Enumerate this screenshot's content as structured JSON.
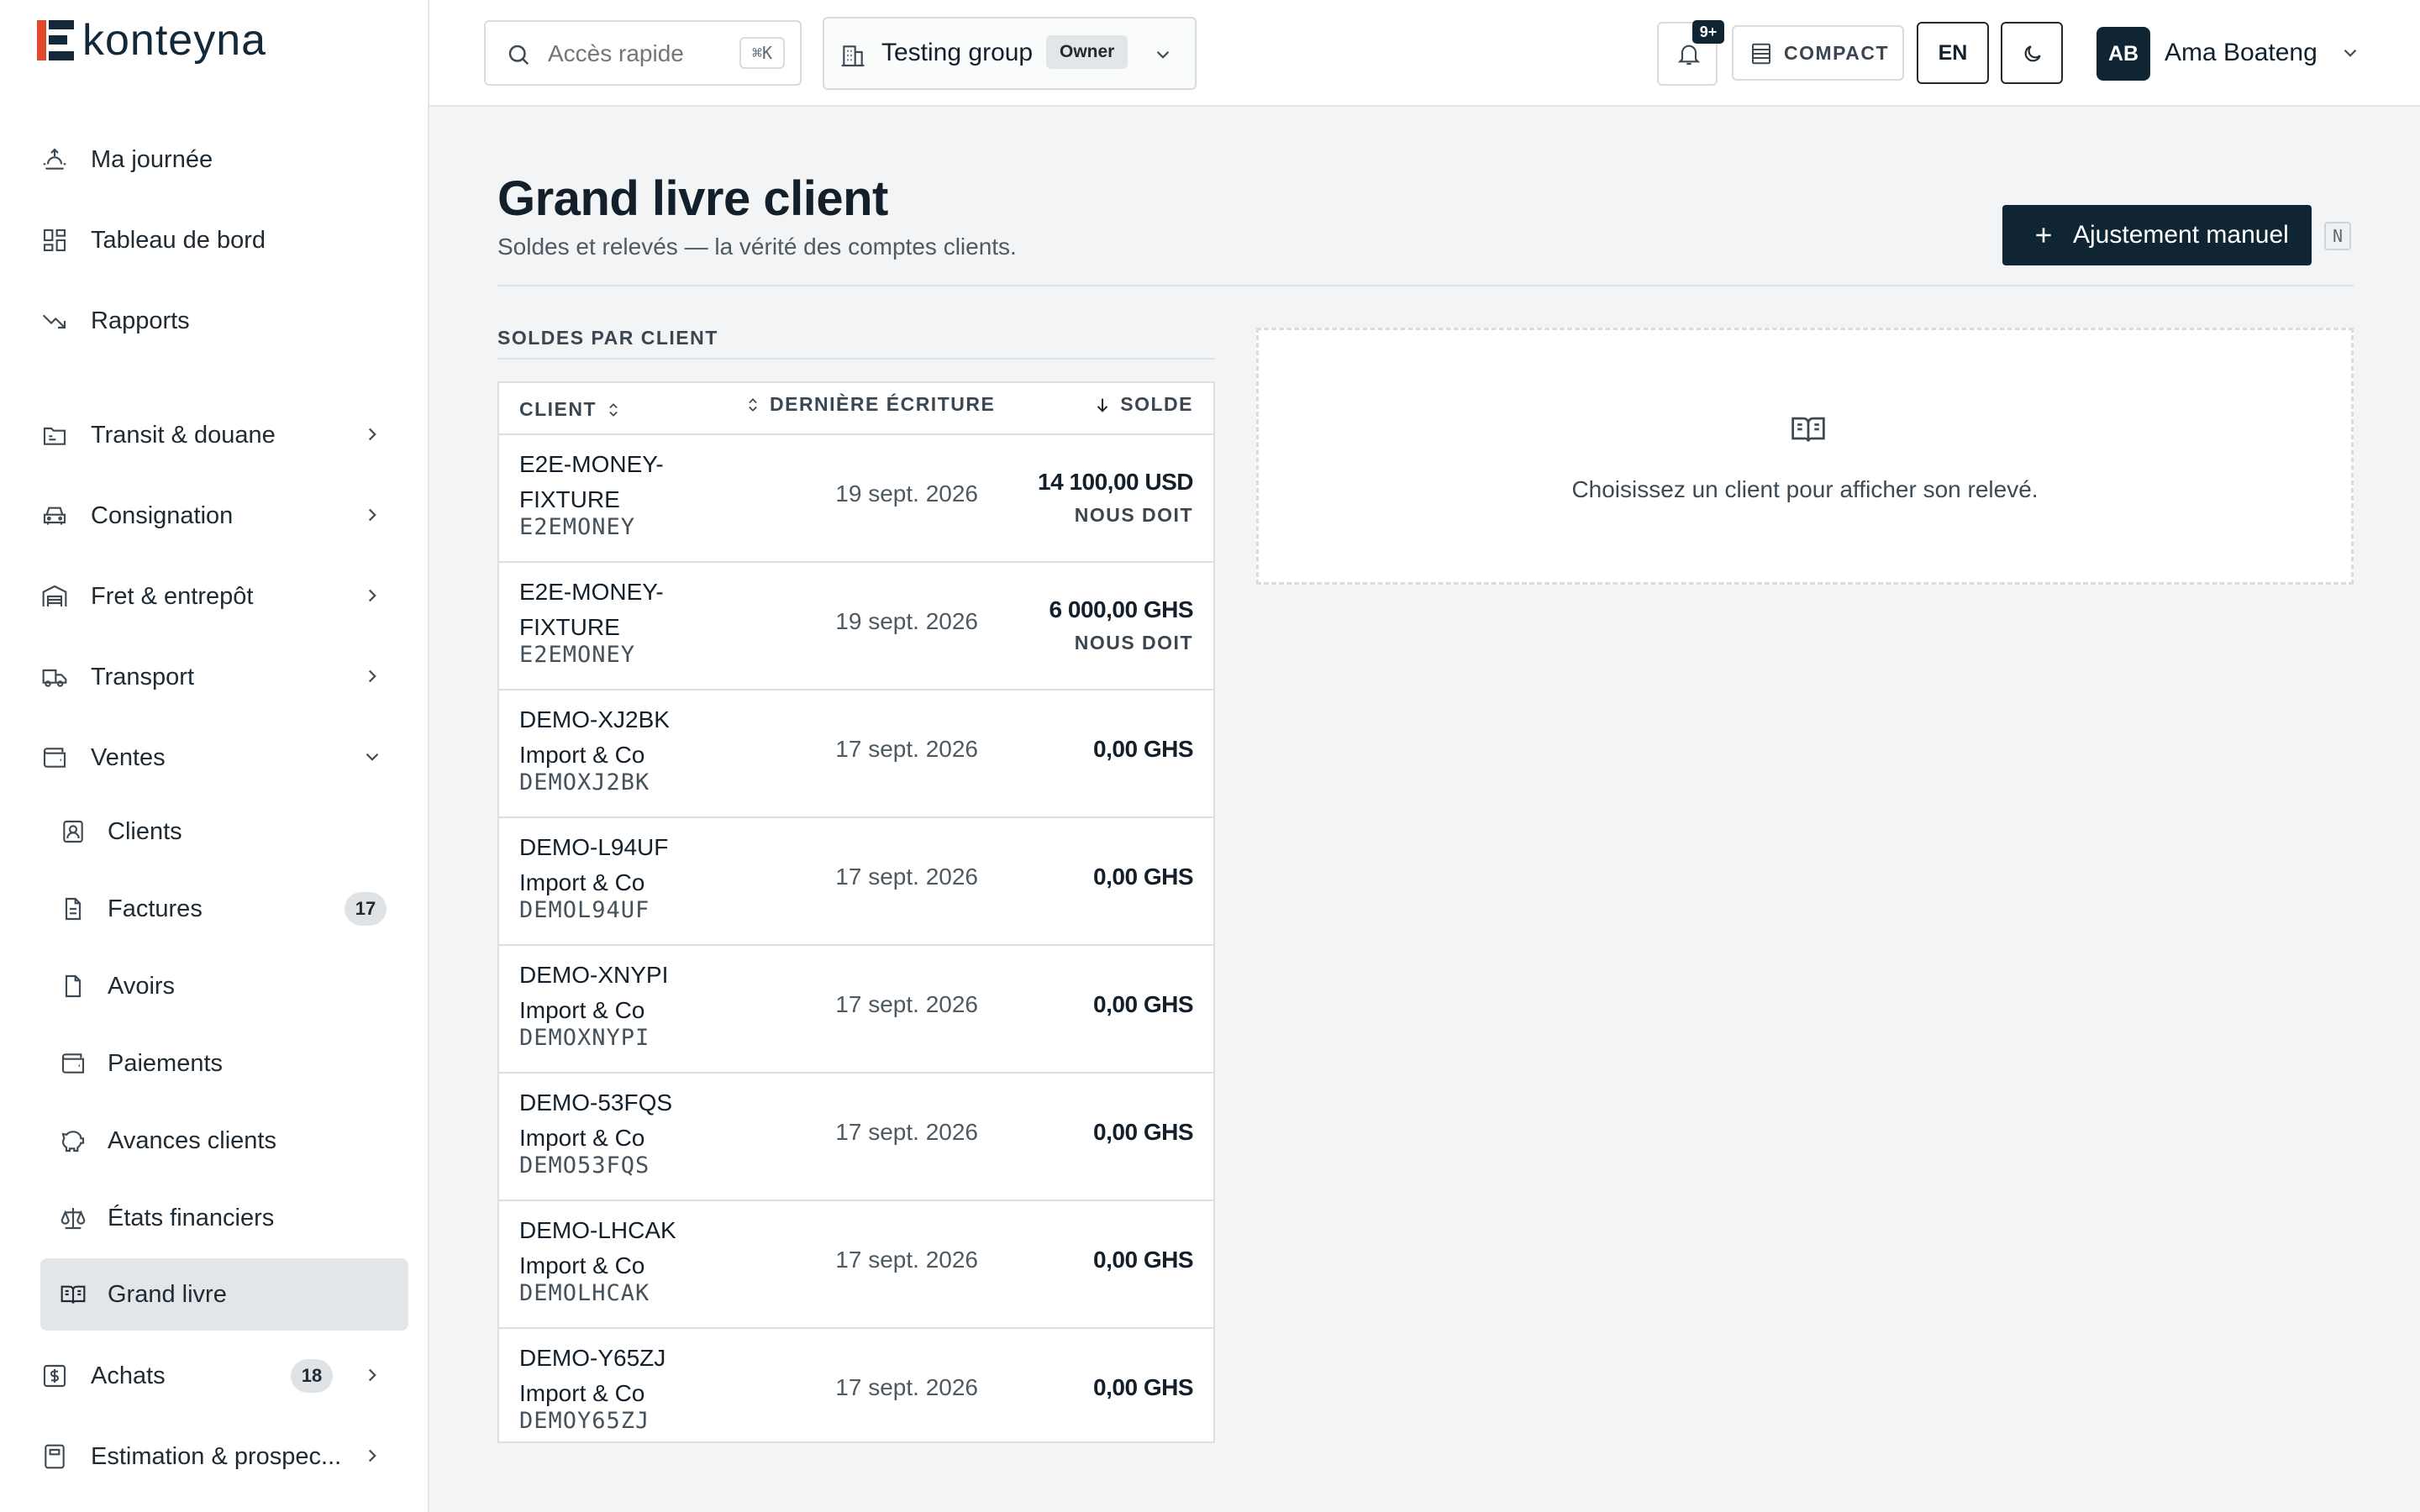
{
  "app": {
    "name": "konteyna"
  },
  "sidebar": {
    "items": [
      {
        "label": "Ma journée",
        "icon": "sunrise-icon"
      },
      {
        "label": "Tableau de bord",
        "icon": "dashboard-icon"
      },
      {
        "label": "Rapports",
        "icon": "trend-down-icon"
      },
      {
        "label": "Transit & douane",
        "icon": "customs-icon"
      },
      {
        "label": "Consignation",
        "icon": "truck-icon"
      },
      {
        "label": "Fret & entrepôt",
        "icon": "warehouse-icon"
      },
      {
        "label": "Transport",
        "icon": "transport-icon"
      },
      {
        "label": "Ventes",
        "icon": "wallet-icon"
      },
      {
        "label": "Achats",
        "icon": "dollar-icon",
        "badge": "18"
      },
      {
        "label": "Estimation & prospec...",
        "icon": "calculator-icon"
      }
    ],
    "ventes_sub": [
      {
        "label": "Clients",
        "icon": "contact-icon"
      },
      {
        "label": "Factures",
        "icon": "invoice-icon",
        "badge": "17"
      },
      {
        "label": "Avoirs",
        "icon": "document-icon"
      },
      {
        "label": "Paiements",
        "icon": "wallet-icon"
      },
      {
        "label": "Avances clients",
        "icon": "piggy-bank-icon"
      },
      {
        "label": "États financiers",
        "icon": "scale-icon"
      },
      {
        "label": "Grand livre",
        "icon": "book-icon",
        "active": true
      }
    ]
  },
  "topbar": {
    "search_placeholder": "Accès rapide",
    "search_shortcut": "⌘K",
    "org_name": "Testing group",
    "org_role": "Owner",
    "notifications": "9+",
    "compact_label": "COMPACT",
    "language": "EN",
    "user_initials": "AB",
    "user_name": "Ama Boateng"
  },
  "page": {
    "title": "Grand livre client",
    "subtitle": "Soldes et relevés — la vérité des comptes clients.",
    "primary_button": "Ajustement manuel",
    "primary_shortcut": "N"
  },
  "balances": {
    "section_label": "SOLDES PAR CLIENT",
    "columns": {
      "client": "CLIENT",
      "last_entry": "DERNIÈRE ÉCRITURE",
      "balance": "SOLDE"
    },
    "rows": [
      {
        "name": "E2E-MONEY-FIXTURE",
        "code": "E2EMONEY",
        "date": "19 sept. 2026",
        "amount": "14 100,00 USD",
        "status": "NOUS DOIT"
      },
      {
        "name": "E2E-MONEY-FIXTURE",
        "code": "E2EMONEY",
        "date": "19 sept. 2026",
        "amount": "6 000,00 GHS",
        "status": "NOUS DOIT"
      },
      {
        "name": "DEMO-XJ2BK Import & Co",
        "code": "DEMOXJ2BK",
        "date": "17 sept. 2026",
        "amount": "0,00 GHS",
        "status": ""
      },
      {
        "name": "DEMO-L94UF Import & Co",
        "code": "DEMOL94UF",
        "date": "17 sept. 2026",
        "amount": "0,00 GHS",
        "status": ""
      },
      {
        "name": "DEMO-XNYPI Import & Co",
        "code": "DEMOXNYPI",
        "date": "17 sept. 2026",
        "amount": "0,00 GHS",
        "status": ""
      },
      {
        "name": "DEMO-53FQS Import & Co",
        "code": "DEMO53FQS",
        "date": "17 sept. 2026",
        "amount": "0,00 GHS",
        "status": ""
      },
      {
        "name": "DEMO-LHCAK Import & Co",
        "code": "DEMOLHCAK",
        "date": "17 sept. 2026",
        "amount": "0,00 GHS",
        "status": ""
      },
      {
        "name": "DEMO-Y65ZJ Import & Co",
        "code": "DEMOY65ZJ",
        "date": "17 sept. 2026",
        "amount": "0,00 GHS",
        "status": ""
      }
    ]
  },
  "statement_panel": {
    "empty_message": "Choisissez un client pour afficher son relevé."
  }
}
